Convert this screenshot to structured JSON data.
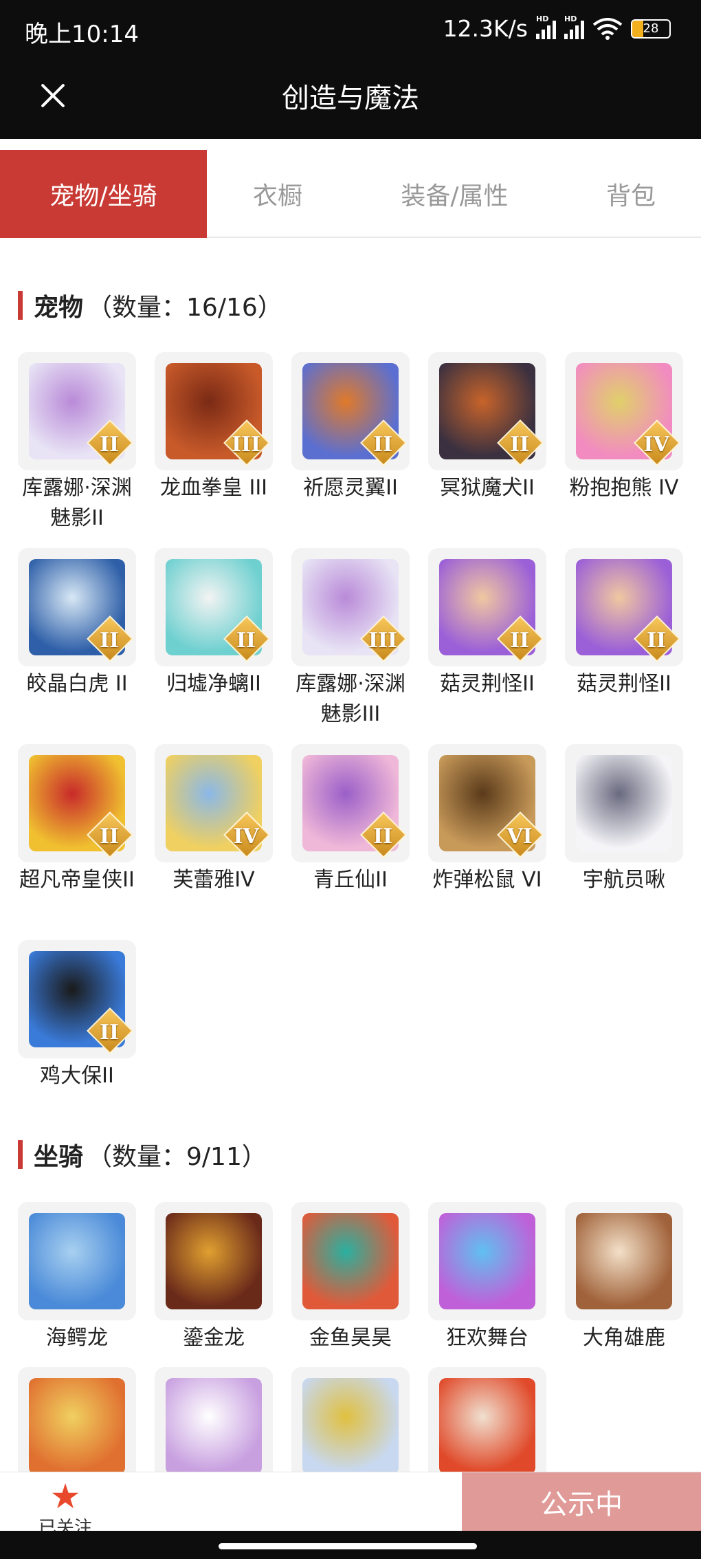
{
  "status": {
    "time": "晚上10:14",
    "speed": "12.3K/s",
    "battery": "28"
  },
  "header": {
    "title": "创造与魔法"
  },
  "tabs": [
    {
      "label": "宠物/坐骑",
      "active": true
    },
    {
      "label": "衣橱",
      "active": false
    },
    {
      "label": "装备/属性",
      "active": false
    },
    {
      "label": "背包",
      "active": false
    }
  ],
  "pets": {
    "title": "宠物",
    "count": "（数量：16/16）",
    "items": [
      {
        "name": "库露娜·深渊魅影II",
        "badge": "II",
        "colors": [
          "#e8e4f5",
          "#b98ad8"
        ]
      },
      {
        "name": "龙血拳皇 III",
        "badge": "III",
        "colors": [
          "#c85a2a",
          "#7a2a15"
        ]
      },
      {
        "name": "祈愿灵翼II",
        "badge": "II",
        "colors": [
          "#5b6fd1",
          "#e07a2a"
        ]
      },
      {
        "name": "冥狱魔犬II",
        "badge": "II",
        "colors": [
          "#3a3040",
          "#c8642a"
        ]
      },
      {
        "name": "粉抱抱熊 IV",
        "badge": "IV",
        "colors": [
          "#f28cc0",
          "#e0d06a"
        ]
      },
      {
        "name": "皎晶白虎 II",
        "badge": "II",
        "colors": [
          "#2e5fa8",
          "#d8e8f5"
        ]
      },
      {
        "name": "归墟净螭II",
        "badge": "II",
        "colors": [
          "#6fd0d0",
          "#f3f3f3"
        ]
      },
      {
        "name": "库露娜·深渊魅影III",
        "badge": "III",
        "colors": [
          "#e8e4f5",
          "#b98ad8"
        ]
      },
      {
        "name": "菇灵荆怪II",
        "badge": "II",
        "colors": [
          "#9b5fd8",
          "#f0c8a0"
        ]
      },
      {
        "name": "菇灵荆怪II",
        "badge": "II",
        "colors": [
          "#9b5fd8",
          "#f0c8a0"
        ]
      },
      {
        "name": "超凡帝皇侠II",
        "badge": "II",
        "colors": [
          "#f0c030",
          "#c82a2a"
        ]
      },
      {
        "name": "芙蕾雅IV",
        "badge": "IV",
        "colors": [
          "#f0d060",
          "#8ab8e8"
        ]
      },
      {
        "name": "青丘仙II",
        "badge": "II",
        "colors": [
          "#f0b8d8",
          "#9a5fc8"
        ]
      },
      {
        "name": "炸弹松鼠 VI",
        "badge": "VI",
        "colors": [
          "#c89a5a",
          "#5a3a1a"
        ]
      },
      {
        "name": "宇航员啾",
        "badge": "",
        "colors": [
          "#f5f5f8",
          "#6a6a80"
        ]
      },
      {
        "name": "鸡大保II",
        "badge": "II",
        "colors": [
          "#3a7ad8",
          "#1a1a1a"
        ]
      }
    ]
  },
  "mounts": {
    "title": "坐骑",
    "count": "（数量：9/11）",
    "items": [
      {
        "name": "海鳄龙",
        "colors": [
          "#4a8ad8",
          "#a8d0f0"
        ]
      },
      {
        "name": "鎏金龙",
        "colors": [
          "#6a2a1a",
          "#e0a030"
        ]
      },
      {
        "name": "金鱼昊昊",
        "colors": [
          "#e05a3a",
          "#2ab0a0"
        ]
      },
      {
        "name": "狂欢舞台",
        "colors": [
          "#c060d8",
          "#60c0f0"
        ]
      },
      {
        "name": "大角雄鹿",
        "colors": [
          "#a0623a",
          "#f3e0c8"
        ]
      },
      {
        "name": "",
        "colors": [
          "#e07030",
          "#f0d060"
        ]
      },
      {
        "name": "",
        "colors": [
          "#c8a0e0",
          "#fff"
        ]
      },
      {
        "name": "",
        "colors": [
          "#c8d8f0",
          "#e0c040"
        ]
      },
      {
        "name": "",
        "colors": [
          "#e04a2a",
          "#f0e0d0"
        ]
      }
    ]
  },
  "bottom": {
    "follow_label": "已关注",
    "public_label": "公示中"
  }
}
